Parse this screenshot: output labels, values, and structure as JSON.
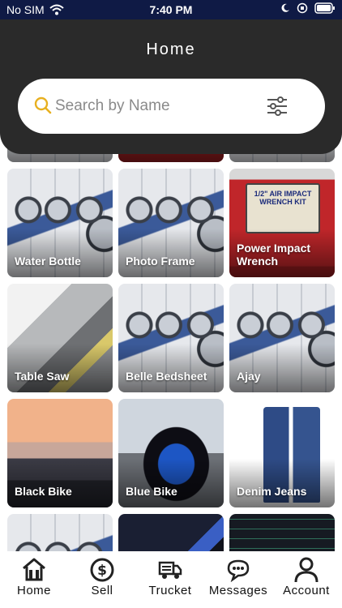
{
  "status_bar": {
    "carrier": "No SIM",
    "time": "7:40 PM"
  },
  "header": {
    "title": "Home"
  },
  "search": {
    "placeholder": "Search by Name"
  },
  "tiles": [
    {
      "label": "",
      "image": "partial-tile"
    },
    {
      "label": "",
      "image": "partial-tile"
    },
    {
      "label": "",
      "image": "partial-tile"
    },
    {
      "label": "Water Bottle",
      "image": "laundry"
    },
    {
      "label": "Photo Frame",
      "image": "laundry"
    },
    {
      "label": "Power Impact Wrench",
      "image": "wrench-kit"
    },
    {
      "label": "Table Saw",
      "image": "table-saw"
    },
    {
      "label": "Belle Bedsheet",
      "image": "laundry"
    },
    {
      "label": "Ajay",
      "image": "laundry"
    },
    {
      "label": "Black Bike",
      "image": "black-motorbike"
    },
    {
      "label": "Blue Bike",
      "image": "blue-motorbike"
    },
    {
      "label": "Denim Jeans",
      "image": "jeans"
    },
    {
      "label": "",
      "image": "laundry"
    },
    {
      "label": "",
      "image": "dark-screen"
    },
    {
      "label": "",
      "image": "code-screen"
    }
  ],
  "wrench_box_text": "1/2\" AIR IMPACT WRENCH KIT",
  "nav": [
    {
      "label": "Home",
      "icon": "home-icon"
    },
    {
      "label": "Sell",
      "icon": "dollar-icon"
    },
    {
      "label": "Trucket",
      "icon": "truck-icon"
    },
    {
      "label": "Messages",
      "icon": "chat-icon"
    },
    {
      "label": "Account",
      "icon": "user-icon"
    }
  ],
  "colors": {
    "header_bg": "#2a2a2a",
    "status_bg": "#0f1a45",
    "search_icon": "#e8b020"
  }
}
